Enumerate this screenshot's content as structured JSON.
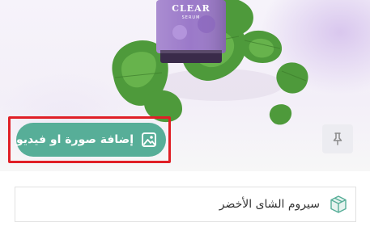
{
  "hero": {
    "product_label": "CLEAR",
    "product_sublabel": "SERUM",
    "add_media_label": "إضافة صورة او فيديو"
  },
  "product": {
    "name": "سيروم الشاى الأخضر"
  },
  "colors": {
    "accent": "#57ae98",
    "highlight": "#e01f26",
    "bottle": "#9b79c9"
  },
  "icons": {
    "add_media": "image-icon",
    "pin": "pin-icon",
    "product": "box-icon"
  }
}
